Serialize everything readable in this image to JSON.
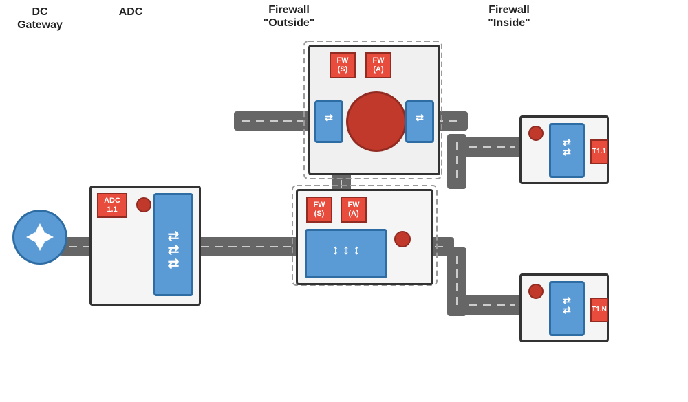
{
  "labels": {
    "dc_gateway": "DC\nGateway",
    "adc": "ADC",
    "firewall_outside": "Firewall\n\"Outside\"",
    "firewall_inside": "Firewall\n\"Inside\"",
    "adc_device": "ADC\n1.1",
    "fw_s_top": "FW\n(S)",
    "fw_a_top": "FW\n(A)",
    "fw_s_mid": "FW\n(S)",
    "fw_a_mid": "FW\n(A)",
    "t1_1": "T1.1",
    "t1_n": "T1.N"
  },
  "colors": {
    "blue": "#5b9bd5",
    "blue_border": "#2e6da4",
    "red": "#c0392b",
    "red_label": "#e74c3c",
    "gray": "#666",
    "light_gray": "#b0b0b0",
    "box_bg": "#f5f5f5",
    "box_border": "#333"
  }
}
